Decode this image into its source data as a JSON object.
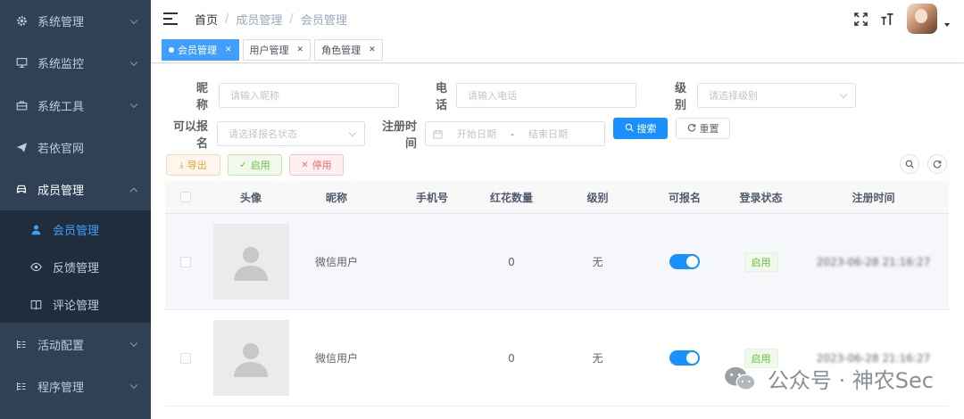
{
  "sidebar": {
    "items": [
      {
        "label": "系统管理",
        "icon": "gear-icon"
      },
      {
        "label": "系统监控",
        "icon": "monitor-icon"
      },
      {
        "label": "系统工具",
        "icon": "toolbox-icon"
      },
      {
        "label": "若依官网",
        "icon": "paper-plane-icon"
      },
      {
        "label": "成员管理",
        "icon": "car-icon"
      }
    ],
    "subitems": [
      {
        "label": "会员管理",
        "icon": "user-icon"
      },
      {
        "label": "反馈管理",
        "icon": "eye-icon"
      },
      {
        "label": "评论管理",
        "icon": "book-icon"
      }
    ],
    "items_after": [
      {
        "label": "活动配置",
        "icon": "list-icon"
      },
      {
        "label": "程序管理",
        "icon": "list-icon"
      }
    ]
  },
  "header": {
    "breadcrumb": [
      "首页",
      "成员管理",
      "会员管理"
    ]
  },
  "tags": [
    {
      "label": "会员管理",
      "active": true
    },
    {
      "label": "用户管理",
      "active": false
    },
    {
      "label": "角色管理",
      "active": false
    }
  ],
  "search": {
    "nickname_label": "昵称",
    "nickname_placeholder": "请输入昵称",
    "phone_label": "电话",
    "phone_placeholder": "请输入电话",
    "level_label": "级别",
    "level_placeholder": "请选择级别",
    "signup_label": "可以报名",
    "signup_placeholder": "请选择报名状态",
    "regtime_label": "注册时间",
    "start_placeholder": "开始日期",
    "range_sep": "-",
    "end_placeholder": "结束日期",
    "search_btn": "搜索",
    "reset_btn": "重置"
  },
  "toolbar": {
    "export": "导出",
    "enable": "启用",
    "disable": "停用"
  },
  "table": {
    "columns": [
      "头像",
      "昵称",
      "手机号",
      "红花数量",
      "级别",
      "可报名",
      "登录状态",
      "注册时间"
    ],
    "rows": [
      {
        "nickname": "微信用户",
        "phone": "",
        "flowers": "0",
        "level": "无",
        "status": "启用",
        "regtime": "2023-06-28 21:16:27"
      },
      {
        "nickname": "微信用户",
        "phone": "",
        "flowers": "0",
        "level": "无",
        "status": "启用",
        "regtime": "2023-06-28 21:16:27"
      }
    ]
  },
  "watermark": "公众号 · 神农Sec",
  "colors": {
    "sidebar": "#304156",
    "primary": "#1890ff",
    "success": "#67c23a"
  }
}
